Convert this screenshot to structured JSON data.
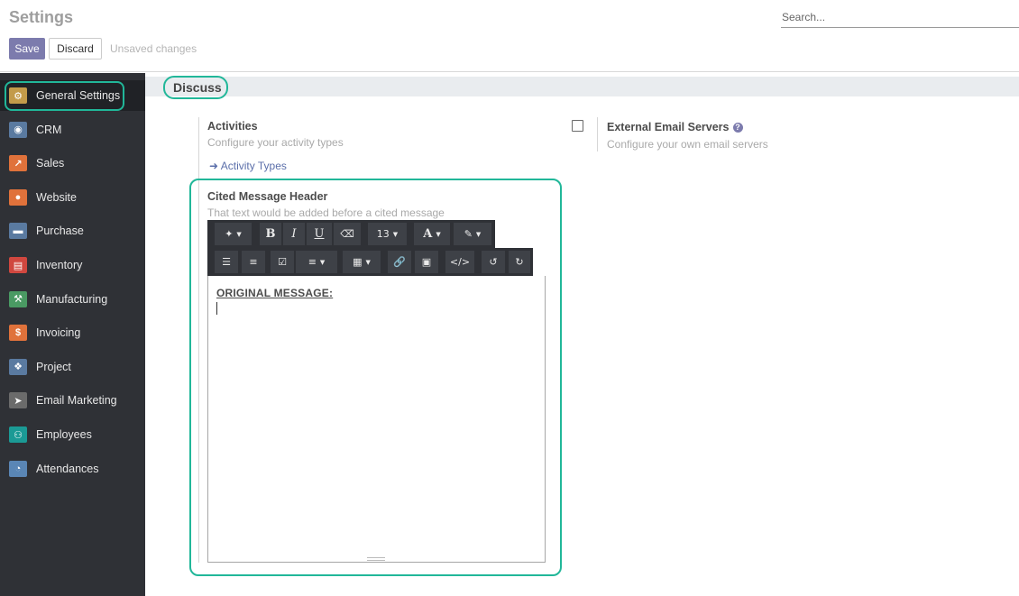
{
  "page": {
    "title": "Settings"
  },
  "search": {
    "placeholder": "Search..."
  },
  "buttons": {
    "save": "Save",
    "discard": "Discard",
    "unsaved": "Unsaved changes"
  },
  "sidebar": {
    "items": [
      {
        "label": "General Settings",
        "icon": "gear-icon",
        "color": "#c39b4a"
      },
      {
        "label": "CRM",
        "icon": "handshake-icon",
        "color": "#5a7aa0"
      },
      {
        "label": "Sales",
        "icon": "chart-icon",
        "color": "#e0723b"
      },
      {
        "label": "Website",
        "icon": "globe-icon",
        "color": "#e0723b"
      },
      {
        "label": "Purchase",
        "icon": "card-icon",
        "color": "#5a7aa0"
      },
      {
        "label": "Inventory",
        "icon": "box-icon",
        "color": "#d0473f"
      },
      {
        "label": "Manufacturing",
        "icon": "wrench-icon",
        "color": "#4a9a63"
      },
      {
        "label": "Invoicing",
        "icon": "invoice-icon",
        "color": "#e0723b"
      },
      {
        "label": "Project",
        "icon": "puzzle-icon",
        "color": "#5a7aa0"
      },
      {
        "label": "Email Marketing",
        "icon": "paper-plane-icon",
        "color": "#6b6b6b"
      },
      {
        "label": "Employees",
        "icon": "users-icon",
        "color": "#1b9a95"
      },
      {
        "label": "Attendances",
        "icon": "user-clock-icon",
        "color": "#5a86b5"
      }
    ]
  },
  "section": {
    "title": "Discuss"
  },
  "settings": {
    "activities": {
      "title": "Activities",
      "desc": "Configure your activity types",
      "link": "Activity Types"
    },
    "external_email": {
      "title": "External Email Servers",
      "desc": "Configure your own email servers",
      "checked": false
    },
    "cited_header": {
      "title": "Cited Message Header",
      "desc": "That text would be added before a cited message"
    }
  },
  "editor": {
    "font_size": "13",
    "content": "ORIGINAL MESSAGE:",
    "toolbar": {
      "bold": "B",
      "italic": "I",
      "underline": "U",
      "font_color": "A"
    }
  }
}
